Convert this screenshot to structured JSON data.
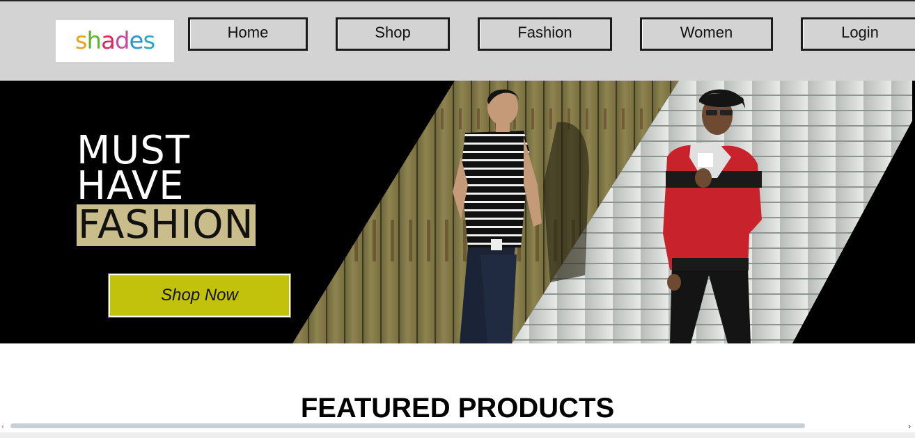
{
  "header": {
    "logo": {
      "letters": [
        "s",
        "h",
        "a",
        "d",
        "e",
        "s"
      ],
      "letter_colors": [
        "#e8a21c",
        "#5bb531",
        "#e2245b",
        "#c44a9e",
        "#2a96d1",
        "#2aa6c9"
      ]
    },
    "nav": [
      "Home",
      "Shop",
      "Fashion",
      "Women",
      "Login"
    ]
  },
  "hero": {
    "headline_lines": [
      "MUST",
      "HAVE"
    ],
    "headline_accent": "FASHION",
    "accent_color": "#c9bd8c",
    "cta_label": "Shop Now",
    "cta_color": "#c2c20c"
  },
  "featured": {
    "title": "FEATURED PRODUCTS"
  },
  "scrollbar": {
    "left_arrow": "‹",
    "right_arrow": "›"
  }
}
